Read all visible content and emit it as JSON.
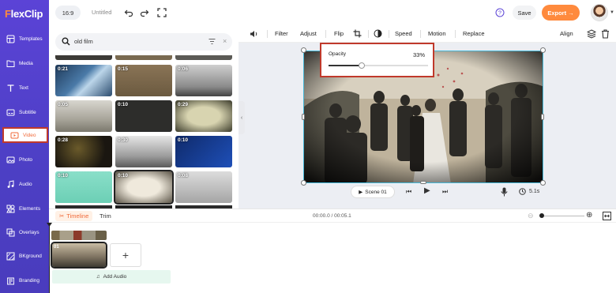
{
  "app": {
    "logo_prefix": "F",
    "logo_rest": "lexClip"
  },
  "topbar": {
    "ratio": "16:9",
    "title": "Untitled",
    "save_label": "Save",
    "export_label": "Export"
  },
  "sidebar": {
    "items": [
      {
        "label": "Templates",
        "icon": "templates-icon"
      },
      {
        "label": "Media",
        "icon": "media-icon"
      },
      {
        "label": "Text",
        "icon": "text-icon"
      },
      {
        "label": "Subtitle",
        "icon": "subtitle-icon"
      },
      {
        "label": "Video",
        "icon": "video-icon",
        "active": true
      },
      {
        "label": "Photo",
        "icon": "photo-icon"
      },
      {
        "label": "Audio",
        "icon": "audio-icon"
      },
      {
        "label": "Elements",
        "icon": "elements-icon"
      },
      {
        "label": "Overlays",
        "icon": "overlays-icon"
      },
      {
        "label": "BKground",
        "icon": "bkground-icon"
      },
      {
        "label": "Branding",
        "icon": "branding-icon"
      }
    ]
  },
  "search": {
    "query": "old film"
  },
  "media": {
    "thumbs": [
      {
        "dur": "0:21"
      },
      {
        "dur": "0:15"
      },
      {
        "dur": "0:06"
      },
      {
        "dur": "0:05"
      },
      {
        "dur": "0:10"
      },
      {
        "dur": "0:29"
      },
      {
        "dur": "0:28"
      },
      {
        "dur": "0:30"
      },
      {
        "dur": "0:10"
      },
      {
        "dur": "0:10"
      },
      {
        "dur": "0:10"
      },
      {
        "dur": "0:08"
      }
    ]
  },
  "edit_bar": {
    "filter": "Filter",
    "adjust": "Adjust",
    "flip": "Flip",
    "speed": "Speed",
    "motion": "Motion",
    "replace": "Replace",
    "align": "Align"
  },
  "opacity": {
    "label": "Opacity",
    "value_text": "33%",
    "value": 0.33
  },
  "player": {
    "scene_label": "Scene 01",
    "duration": "5.1s"
  },
  "timeline": {
    "tab_label": "Timeline",
    "trim_label": "Trim",
    "time": "00:00.0 / 00:05.1",
    "add_audio_label": "Add Audio",
    "clip_index": "01"
  },
  "colors": {
    "accent": "#ff8a3d",
    "sidebar": "#5b43d6",
    "highlight": "#c0392b"
  }
}
